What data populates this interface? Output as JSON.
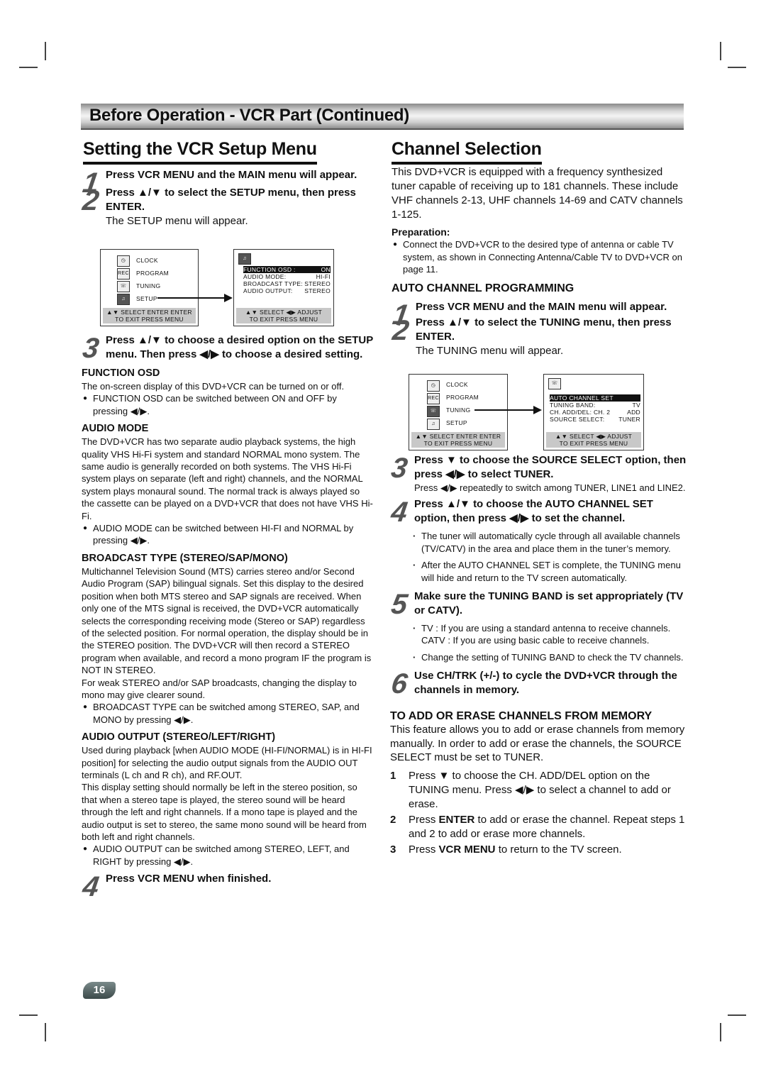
{
  "banner_title": "Before Operation - VCR Part (Continued)",
  "left": {
    "title": "Setting the VCR Setup Menu",
    "steps": [
      {
        "num": "1",
        "text": "Press VCR MENU and the MAIN menu will appear."
      },
      {
        "num": "2",
        "text": "Press ▲/▼ to select the SETUP menu, then press ENTER.",
        "note": "The SETUP menu will appear."
      },
      {
        "num": "3",
        "text": "Press ▲/▼ to choose a desired option on the SETUP menu. Then press ◀/▶ to choose a desired setting."
      },
      {
        "num": "4",
        "text": "Press  VCR MENU when finished."
      }
    ],
    "main_menu": {
      "items": [
        "CLOCK",
        "PROGRAM",
        "TUNING",
        "SETUP"
      ],
      "icons": [
        "clock-icon",
        "program-rec-icon",
        "tuning-icon",
        "setup-icon"
      ],
      "footer1": "▲▼ SELECT ENTER ENTER",
      "footer2": "TO  EXIT PRESS MENU"
    },
    "setup_menu": {
      "rows": [
        {
          "label": "FUNCTION OSD :",
          "value": "ON"
        },
        {
          "label": "AUDIO MODE:",
          "value": "HI-FI"
        },
        {
          "label": "BROADCAST TYPE:",
          "value": "STEREO"
        },
        {
          "label": "AUDIO OUTPUT:",
          "value": "STEREO"
        }
      ],
      "footer1": "▲▼ SELECT   ◀▶ ADJUST",
      "footer2": "TO  EXIT PRESS MENU"
    },
    "sections": [
      {
        "heading": "FUNCTION OSD",
        "paras": [
          "The on-screen display of this DVD+VCR can be turned on or off."
        ],
        "bullet": "FUNCTION OSD can be switched between ON and OFF by pressing ◀/▶."
      },
      {
        "heading": "AUDIO MODE",
        "paras": [
          "The DVD+VCR has two separate audio playback systems, the high quality VHS Hi-Fi system and standard NORMAL mono system. The same audio is generally recorded on both systems. The VHS Hi-Fi system plays on separate (left and right) channels, and the NORMAL system plays monaural sound. The normal track is always played so the cassette can be played on a DVD+VCR that does not have VHS Hi-Fi."
        ],
        "bullet": "AUDIO MODE can be switched between HI-FI and NORMAL by pressing ◀/▶."
      },
      {
        "heading": "BROADCAST TYPE (STEREO/SAP/MONO)",
        "paras": [
          "Multichannel Television Sound (MTS) carries stereo and/or Second Audio Program (SAP) bilingual signals. Set this display to the desired position when both MTS stereo and SAP signals are received. When only one of the MTS signal is received, the DVD+VCR automatically selects the corresponding receiving mode (Stereo or SAP) regardless of the selected position. For normal operation, the display should be in the STEREO position. The DVD+VCR will then record a STEREO program when available, and record a mono program IF the program is NOT IN STEREO.",
          "For weak STEREO and/or SAP broadcasts, changing the display to mono may give clearer sound."
        ],
        "bullet": "BROADCAST TYPE can be switched among STEREO, SAP, and MONO by pressing ◀/▶."
      },
      {
        "heading": "AUDIO OUTPUT (STEREO/LEFT/RIGHT)",
        "paras": [
          "Used during playback [when AUDIO MODE (HI-FI/NORMAL) is in HI-FI position] for selecting the audio output signals from the AUDIO OUT terminals (L ch and R ch), and RF.OUT.",
          "This display setting should normally be left in the stereo position, so that when a stereo tape is played, the stereo sound will be heard through the left and right channels. If a mono tape is played and the audio output is set to stereo, the same mono sound will be heard from both left and right channels."
        ],
        "bullet": "AUDIO OUTPUT can be switched among STEREO, LEFT, and RIGHT by pressing ◀/▶."
      }
    ]
  },
  "right": {
    "title": "Channel Selection",
    "intro": "This DVD+VCR is equipped with a frequency synthesized tuner capable of receiving up to 181 channels. These include VHF channels 2-13, UHF channels 14-69 and CATV channels 1-125.",
    "prep_label": "Preparation:",
    "prep_bullet": "Connect the DVD+VCR to the desired type of antenna or cable TV system, as shown in Connecting Antenna/Cable TV to DVD+VCR on page 11.",
    "auto_heading": "AUTO CHANNEL PROGRAMMING",
    "steps": [
      {
        "num": "1",
        "text": "Press VCR MENU and the MAIN menu will appear."
      },
      {
        "num": "2",
        "text": "Press ▲/▼ to select the TUNING menu, then press ENTER.",
        "note": "The TUNING menu will appear."
      },
      {
        "num": "3",
        "text": "Press ▼ to choose the SOURCE SELECT option, then press ◀/▶ to select TUNER.",
        "note": "Press ◀/▶ repeatedly to switch among TUNER, LINE1 and LINE2."
      },
      {
        "num": "4",
        "text": "Press ▲/▼ to choose the AUTO CHANNEL SET option, then press ◀/▶ to set the channel.",
        "dots": [
          "The tuner will automatically cycle through all available channels (TV/CATV) in the area and place them in the tuner’s memory.",
          "After the AUTO CHANNEL SET is complete, the TUNING menu will hide and return to the TV screen automatically."
        ]
      },
      {
        "num": "5",
        "text": "Make sure the TUNING BAND is set appropriately (TV or CATV).",
        "dots": [
          "TV : If you are using a standard antenna to receive channels.\nCATV : If you are using basic cable to receive channels.",
          "Change the setting of TUNING BAND to check the TV channels."
        ]
      },
      {
        "num": "6",
        "text": "Use CH/TRK (+/-) to cycle the DVD+VCR through the channels in memory."
      }
    ],
    "main_menu": {
      "items": [
        "CLOCK",
        "PROGRAM",
        "TUNING",
        "SETUP"
      ],
      "footer1": "▲▼ SELECT ENTER ENTER",
      "footer2": "TO  EXIT PRESS MENU"
    },
    "tuning_menu": {
      "rows": [
        {
          "label": "AUTO CHANNEL SET",
          "value": ""
        },
        {
          "label": "TUNING BAND:",
          "value": "TV"
        },
        {
          "label": "CH.  ADD/DEL: CH. 2",
          "value": "ADD"
        },
        {
          "label": "SOURCE  SELECT:",
          "value": "TUNER"
        }
      ],
      "footer1": "▲▼ SELECT   ◀▶ ADJUST",
      "footer2": "TO  EXIT PRESS MENU"
    },
    "add_heading": "TO ADD OR ERASE CHANNELS FROM MEMORY",
    "add_intro": "This feature allows you to add or erase channels from memory manually. In order to add or erase the channels, the SOURCE SELECT must be set to TUNER.",
    "add_steps": [
      {
        "n": "1",
        "pre": "Press ▼ to choose the CH. ADD/DEL option on the TUNING menu. Press ◀/▶ to select a channel to add or erase.",
        "bold": "",
        "post": ""
      },
      {
        "n": "2",
        "pre": "Press ",
        "bold": "ENTER",
        "post": " to add or erase the channel. Repeat steps 1 and 2 to add or erase more channels."
      },
      {
        "n": "3",
        "pre": "Press ",
        "bold": "VCR MENU",
        "post": " to return to the TV screen."
      }
    ]
  },
  "page_number": "16"
}
